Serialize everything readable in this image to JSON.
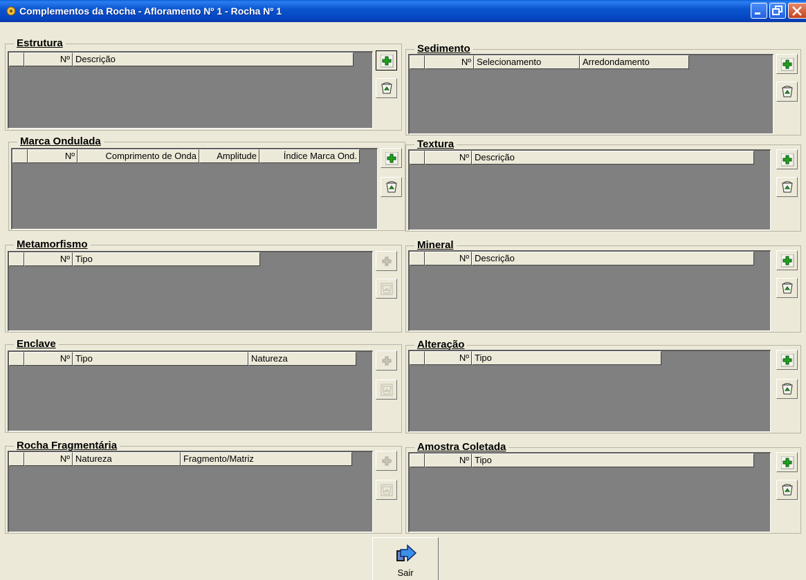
{
  "window": {
    "title": "Complementos da Rocha - Afloramento Nº 1 - Rocha Nº 1"
  },
  "groups": {
    "estrutura": {
      "title": "Estrutura",
      "columns": [
        "Nº",
        "Descrição"
      ]
    },
    "sedimento": {
      "title": "Sedimento",
      "columns": [
        "Nº",
        "Selecionamento",
        "Arredondamento"
      ]
    },
    "marca": {
      "title": "Marca Ondulada",
      "columns": [
        "Nº",
        "Comprimento de Onda",
        "Amplitude",
        "Índice Marca Ond."
      ]
    },
    "textura": {
      "title": "Textura",
      "columns": [
        "Nº",
        "Descrição"
      ]
    },
    "metamorfismo": {
      "title": "Metamorfismo",
      "columns": [
        "Nº",
        "Tipo"
      ],
      "buttons_enabled": false
    },
    "mineral": {
      "title": "Mineral",
      "columns": [
        "Nº",
        "Descrição"
      ]
    },
    "enclave": {
      "title": "Enclave",
      "columns": [
        "Nº",
        "Tipo",
        "Natureza"
      ],
      "buttons_enabled": false
    },
    "alteracao": {
      "title": "Alteração",
      "columns": [
        "Nº",
        "Tipo"
      ]
    },
    "rocha": {
      "title": "Rocha Fragmentária",
      "columns": [
        "Nº",
        "Natureza",
        "Fragmento/Matriz"
      ],
      "buttons_enabled": false
    },
    "amostra": {
      "title": "Amostra Coletada",
      "columns": [
        "Nº",
        "Tipo"
      ]
    }
  },
  "buttons": {
    "add_icon": "green-plus-icon",
    "delete_icon": "trash-bin-icon"
  },
  "footer": {
    "exit_label": "Sair",
    "exit_icon": "exit-arrow-icon"
  },
  "colors": {
    "titlebar": "#0a56d0",
    "grid_bg": "#808080",
    "face": "#ece9d8"
  }
}
